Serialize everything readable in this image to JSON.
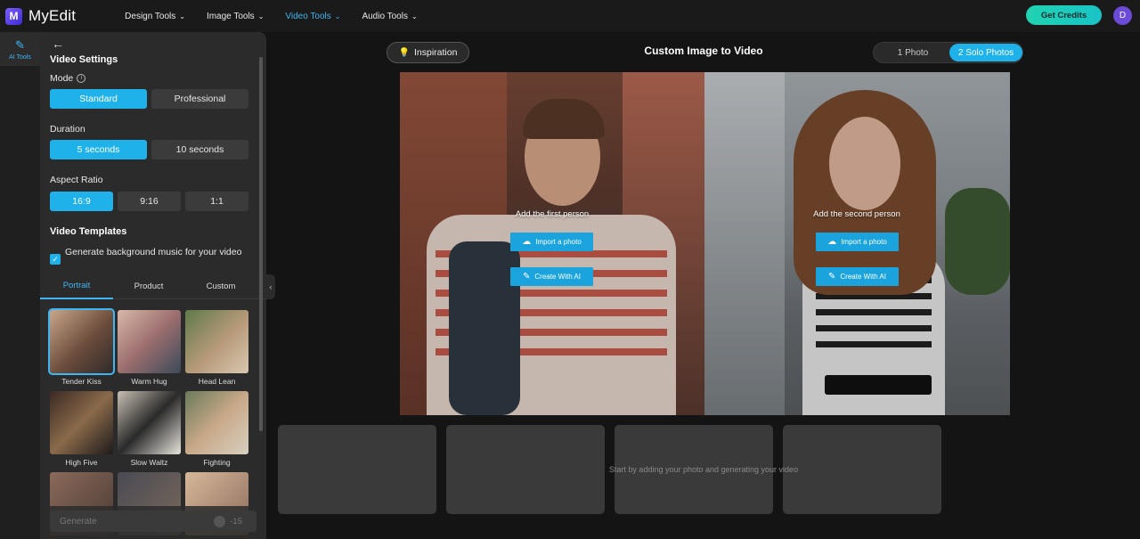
{
  "app": {
    "name": "MyEdit",
    "logo_glyph": "M"
  },
  "nav": [
    {
      "label": "Design Tools"
    },
    {
      "label": "Image Tools"
    },
    {
      "label": "Video Tools",
      "active": true
    },
    {
      "label": "Audio Tools"
    }
  ],
  "header": {
    "credits_label": "Get Credits",
    "avatar_initial": "D"
  },
  "rail": {
    "ai_tools_label": "AI Tools"
  },
  "panel": {
    "title": "Video Settings",
    "mode_label": "Mode",
    "mode_options": [
      "Standard",
      "Professional"
    ],
    "mode_selected": "Standard",
    "duration_label": "Duration",
    "duration_options": [
      "5 seconds",
      "10 seconds"
    ],
    "duration_selected": "5 seconds",
    "aspect_label": "Aspect Ratio",
    "aspect_options": [
      "16:9",
      "9:16",
      "1:1"
    ],
    "aspect_selected": "16:9",
    "templates_title": "Video Templates",
    "bg_music_label": "Generate background music for your video",
    "bg_music_checked": true,
    "tabs": [
      "Portrait",
      "Product",
      "Custom"
    ],
    "tab_active": "Portrait",
    "templates": [
      {
        "name": "Tender Kiss",
        "selected": true
      },
      {
        "name": "Warm Hug"
      },
      {
        "name": "Head Lean"
      },
      {
        "name": "High Five"
      },
      {
        "name": "Slow Waltz"
      },
      {
        "name": "Fighting"
      }
    ],
    "generate_label": "Generate",
    "generate_cost": "-15"
  },
  "main": {
    "inspiration_label": "Inspiration",
    "title": "Custom Image to Video",
    "photo_modes": [
      "1 Photo",
      "2 Solo Photos"
    ],
    "photo_mode_selected": "2 Solo Photos",
    "first_person_label": "Add the first person",
    "second_person_label": "Add the second person",
    "import_label": "Import a photo",
    "create_label": "Create With AI",
    "empty_hint": "Start by adding your photo and generating your video"
  },
  "colors": {
    "accent": "#1fb2ea",
    "credits": "#20d3b1",
    "avatar": "#6b4bd8"
  }
}
